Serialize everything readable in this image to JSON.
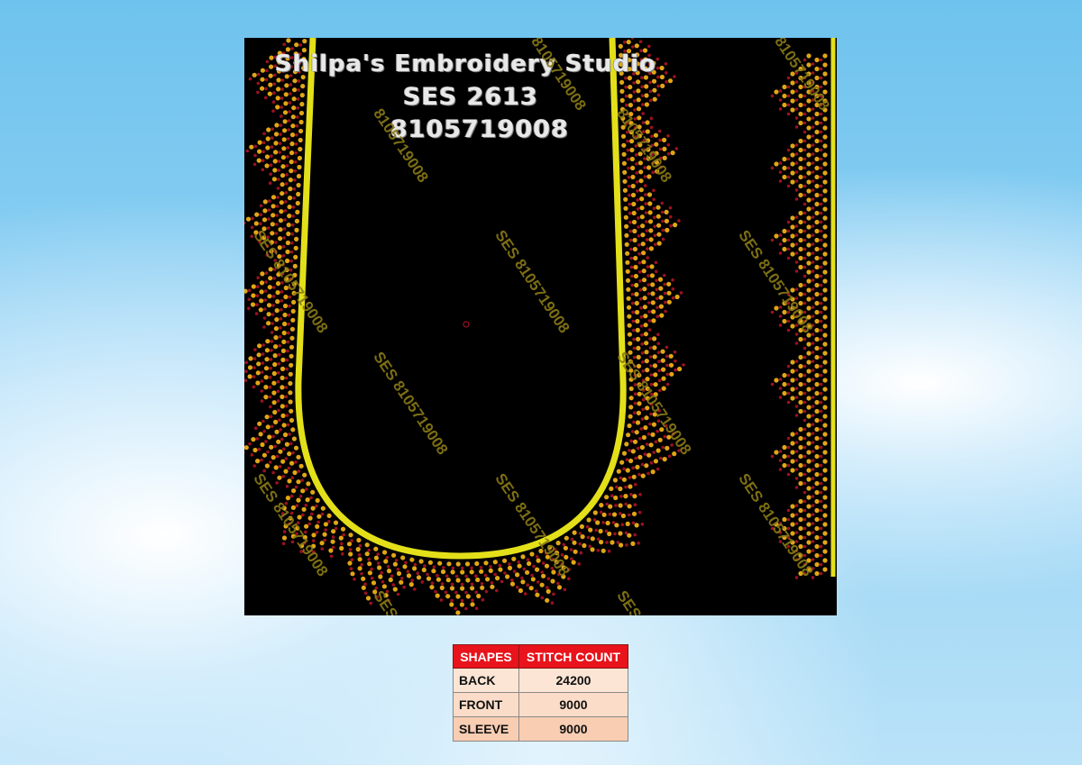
{
  "design": {
    "studio_name": "Shilpa's Embroidery Studio",
    "design_code": "SES 2613",
    "phone": "8105719008",
    "watermarks": [
      "SES 8105719008",
      "8105719008"
    ]
  },
  "colors": {
    "panel_background": "#000000",
    "outline": "#e3e01a",
    "bead_gold": "#e0a615",
    "bead_maroon": "#9c1022",
    "table_header": "#e8131b"
  },
  "table": {
    "headers": [
      "SHAPES",
      "STITCH COUNT"
    ],
    "rows": [
      {
        "shape": "BACK",
        "count": "24200"
      },
      {
        "shape": "FRONT",
        "count": "9000"
      },
      {
        "shape": "SLEEVE",
        "count": "9000"
      }
    ]
  }
}
